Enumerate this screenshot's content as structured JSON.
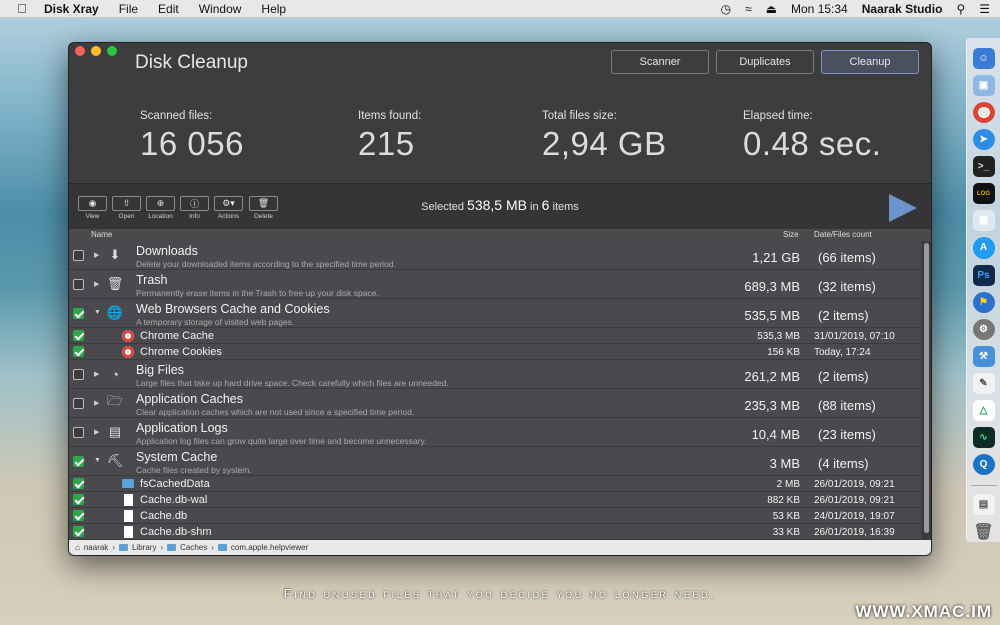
{
  "menubar": {
    "app": "Disk Xray",
    "menus": [
      "File",
      "Edit",
      "Window",
      "Help"
    ],
    "clock": "Mon 15:34",
    "user": "Naarak Studio"
  },
  "window": {
    "title": "Disk Cleanup",
    "tabs": [
      "Scanner",
      "Duplicates",
      "Cleanup"
    ],
    "active_tab": "Cleanup"
  },
  "stats": [
    {
      "label": "Scanned files:",
      "value": "16 056"
    },
    {
      "label": "Items found:",
      "value": "215"
    },
    {
      "label": "Total files size:",
      "value": "2,94 GB"
    },
    {
      "label": "Elapsed time:",
      "value": "0.48 sec."
    }
  ],
  "toolbar": {
    "buttons": [
      "View",
      "Open",
      "Location",
      "Info",
      "Actions",
      "Delete"
    ],
    "selected_prefix": "Selected",
    "selected_size": "538,5 MB",
    "selected_in": "in",
    "selected_count": "6",
    "selected_suffix": "items"
  },
  "columns": {
    "name": "Name",
    "size": "Size",
    "date": "Date/Files count"
  },
  "groups": [
    {
      "name": "Downloads",
      "desc": "Delete your downloaded items according to the specified time period.",
      "size": "1,21 GB",
      "count": "(66 items)",
      "checked": false,
      "expanded": false,
      "icon": "download-icon"
    },
    {
      "name": "Trash",
      "desc": "Permanently erase items in the Trash to free up your disk space.",
      "size": "689,3 MB",
      "count": "(32 items)",
      "checked": false,
      "expanded": false,
      "icon": "trash-icon"
    },
    {
      "name": "Web Browsers Cache and Cookies",
      "desc": "A temporary storage of visited web pages.",
      "size": "535,5 MB",
      "count": "(2 items)",
      "checked": true,
      "expanded": true,
      "icon": "globe-icon"
    },
    {
      "name": "Big Files",
      "desc": "Large files that take up hard drive space. Check carefully which files are unneeded.",
      "size": "261,2 MB",
      "count": "(2 items)",
      "checked": false,
      "expanded": false,
      "icon": "pie-chart-icon"
    },
    {
      "name": "Application Caches",
      "desc": "Clear application caches which are not used since a specified time period.",
      "size": "235,3 MB",
      "count": "(88 items)",
      "checked": false,
      "expanded": false,
      "icon": "folder-icon"
    },
    {
      "name": "Application Logs",
      "desc": "Application log files can grow quite large over time and become unnecessary.",
      "size": "10,4 MB",
      "count": "(23 items)",
      "checked": false,
      "expanded": false,
      "icon": "scroll-icon"
    },
    {
      "name": "System Cache",
      "desc": "Cache files created by system.",
      "size": "3 MB",
      "count": "(4 items)",
      "checked": true,
      "expanded": true,
      "icon": "system-cache-icon"
    }
  ],
  "web_items": [
    {
      "name": "Chrome Cache",
      "size": "535,3 MB",
      "date": "31/01/2019, 07:10"
    },
    {
      "name": "Chrome Cookies",
      "size": "156 KB",
      "date": "Today, 17:24"
    }
  ],
  "system_items": [
    {
      "name": "fsCachedData",
      "size": "2 MB",
      "date": "26/01/2019, 09:21",
      "kind": "folder"
    },
    {
      "name": "Cache.db-wal",
      "size": "882 KB",
      "date": "26/01/2019, 09:21",
      "kind": "file"
    },
    {
      "name": "Cache.db",
      "size": "53 KB",
      "date": "24/01/2019, 19:07",
      "kind": "file"
    },
    {
      "name": "Cache.db-shm",
      "size": "33 KB",
      "date": "26/01/2019, 16:39",
      "kind": "file"
    }
  ],
  "path": [
    "naarak",
    "Library",
    "Caches",
    "com.apple.helpviewer"
  ],
  "caption": "Find unused files that you decide you no longer need.",
  "watermark": "WWW.XMAC.IM",
  "colors": {
    "accent": "#6d94c9",
    "check": "#2ea64a",
    "window_bg": "#3f3f42"
  }
}
